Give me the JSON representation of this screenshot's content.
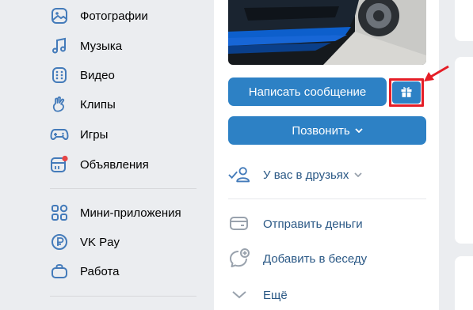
{
  "nav": {
    "items": [
      {
        "label": "Фотографии",
        "icon": "photo-icon"
      },
      {
        "label": "Музыка",
        "icon": "music-icon"
      },
      {
        "label": "Видео",
        "icon": "video-icon"
      },
      {
        "label": "Клипы",
        "icon": "clips-icon"
      },
      {
        "label": "Игры",
        "icon": "gamepad-icon"
      },
      {
        "label": "Объявления",
        "icon": "classifieds-icon"
      }
    ],
    "secondary_items": [
      {
        "label": "Мини-приложения",
        "icon": "apps-grid-icon"
      },
      {
        "label": "VK Pay",
        "icon": "vkpay-icon"
      },
      {
        "label": "Работа",
        "icon": "briefcase-icon"
      }
    ]
  },
  "profile": {
    "message_button": "Написать сообщение",
    "gift_button_icon": "gift-icon",
    "call_button": "Позвонить",
    "friend_status": "У вас в друзьях",
    "actions": [
      {
        "label": "Отправить деньги",
        "icon": "money-transfer-icon"
      },
      {
        "label": "Добавить в беседу",
        "icon": "add-to-chat-icon"
      },
      {
        "label": "Ещё",
        "icon": "chevron-down-icon"
      }
    ]
  },
  "colors": {
    "accent": "#2d81c5",
    "icon": "#447bba",
    "link": "#2a5885",
    "highlight": "#e51d26",
    "background": "#ebedf0"
  }
}
